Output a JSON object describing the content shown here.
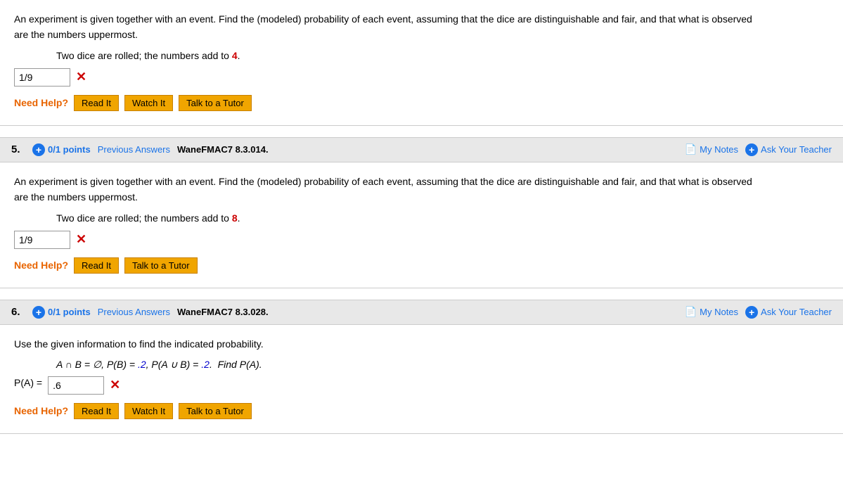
{
  "questions": [
    {
      "number": "5.",
      "points": "0/1 points",
      "prev_answers": "Previous Answers",
      "code": "WaneFMAC7 8.3.014.",
      "my_notes": "My Notes",
      "ask_teacher": "Ask Your Teacher",
      "body_text_line1": "An experiment is given together with an event. Find the (modeled) probability of each event, assuming that the dice are distinguishable and fair, and that what is observed",
      "body_text_line2": "are the numbers uppermost.",
      "sub_question": "Two dice are rolled; the numbers add to ",
      "highlight_number": "8",
      "highlight_color": "red",
      "answer_value": "1/9",
      "need_help": "Need Help?",
      "buttons": [
        "Read It",
        "Talk to a Tutor"
      ],
      "has_watch": false
    },
    {
      "number": "6.",
      "points": "0/1 points",
      "prev_answers": "Previous Answers",
      "code": "WaneFMAC7 8.3.028.",
      "my_notes": "My Notes",
      "ask_teacher": "Ask Your Teacher",
      "body_text_line1": "Use the given information to find the indicated probability.",
      "math_formula": "A ∩ B = ∅, P(B) = .2, P(A ∪ B) = .2.  Find P(A).",
      "pa_label": "P(A) = ",
      "answer_value": ".6",
      "need_help": "Need Help?",
      "buttons": [
        "Read It",
        "Watch It",
        "Talk to a Tutor"
      ],
      "has_watch": true
    }
  ],
  "prev_question": {
    "body_text_line1": "An experiment is given together with an event. Find the (modeled) probability of each event, assuming that the dice are distinguishable and fair, and that what is observed",
    "body_text_line2": "are the numbers uppermost.",
    "sub_question": "Two dice are rolled; the numbers add to ",
    "highlight_number": "4",
    "answer_value": "1/9",
    "need_help": "Need Help?",
    "buttons": [
      "Read It",
      "Watch It",
      "Talk to a Tutor"
    ]
  }
}
